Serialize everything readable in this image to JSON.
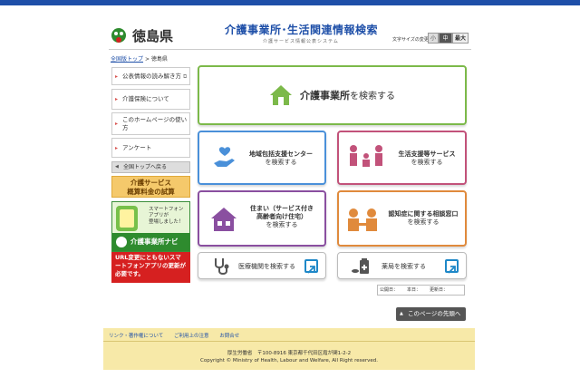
{
  "header": {
    "prefecture": "徳島県",
    "site_title": "介護事業所･生活関連情報検索",
    "site_subtitle": "介護サービス情報公表システム",
    "font_size_label": "文字サイズの変更",
    "font_size_options": [
      "小",
      "中",
      "最大"
    ]
  },
  "breadcrumb": {
    "home": "全国版トップ",
    "sep": ">",
    "current": "徳島県"
  },
  "sidebar": {
    "items": [
      {
        "label": "公表情報の読み解き方"
      },
      {
        "label": "介護保険について"
      },
      {
        "label": "このホームページの使い方"
      },
      {
        "label": "アンケート"
      }
    ],
    "back_label": "全国トップへ戻る",
    "fee_line1": "介護サービス",
    "fee_line2": "概算料金の試算",
    "app_text_1": "スマートフォン",
    "app_text_2": "アプリが",
    "app_text_3": "登場しました！",
    "app_name": "介護事業所ナビ",
    "notice": "URL変更にともないスマートフォンアプリの更新が必要です。"
  },
  "main": {
    "primary": {
      "name": "介護事業所",
      "suffix": "を検索する"
    },
    "cards": [
      {
        "name": "地域包括支援センター",
        "suffix": "を検索する"
      },
      {
        "name": "生活支援等サービス",
        "suffix": "を検索する"
      },
      {
        "name_1": "住まい（サービス付き",
        "name_2": "高齢者向け住宅）",
        "suffix": "を検索する"
      },
      {
        "name": "認知症に関する相談窓口",
        "suffix": "を検索する"
      }
    ],
    "links": [
      {
        "label": "医療機関を検索する"
      },
      {
        "label": "薬局を検索する"
      }
    ]
  },
  "dates": {
    "a": "公開日：",
    "b": "更新日：",
    "c": "本日："
  },
  "page_top": "このページの先頭へ",
  "footer": {
    "links": [
      "リンク・著作権について",
      "ご利用上の注意",
      "お問合せ"
    ],
    "org": "厚生労働省　〒100-8916 東京都千代田区霞が関1-2-2",
    "copyright": "Copyright © Ministry of Health, Labour and Welfare, All Right reserved."
  },
  "colors": {
    "accent": "#1e4fa8",
    "green": "#7cb94a",
    "blue_card": "#4a90d9",
    "pink_card": "#c2527a",
    "purple_card": "#8a4fa0",
    "orange_card": "#e08a3c"
  }
}
